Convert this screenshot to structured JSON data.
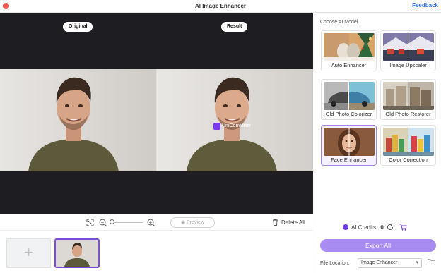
{
  "window": {
    "title": "AI Image Enhancer",
    "feedback_link": "Feedback"
  },
  "preview": {
    "original_label": "Original",
    "result_label": "Result",
    "watermark_text": "UniConverter"
  },
  "toolbar": {
    "icons": [
      "fit-screen-icon",
      "zoom-out-icon",
      "zoom-in-icon",
      "trash-icon",
      "eye-icon"
    ],
    "preview_label": "Preview",
    "delete_all_label": "Delete All",
    "zoom_level": 0.1
  },
  "thumbnails": {
    "add_glyph": "+",
    "count": 1
  },
  "panel": {
    "heading": "Choose AI Model",
    "models": [
      {
        "label": "Auto Enhancer",
        "selected": false
      },
      {
        "label": "Image Upscaler",
        "selected": false
      },
      {
        "label": "Old Photo Colorizer",
        "selected": false
      },
      {
        "label": "Old Photo Restorer",
        "selected": false
      },
      {
        "label": "Face Enhancer",
        "selected": true
      },
      {
        "label": "Color Correction",
        "selected": false
      }
    ],
    "credits_label": "AI Credits:",
    "credits_value": "0",
    "export_label": "Export All",
    "file_location_label": "File Location:",
    "file_location_value": "Image Enhancer"
  },
  "colors": {
    "accent": "#a98cf2",
    "accent_dark": "#7b4ce0",
    "preview_bg": "#1e1e22",
    "close_button": "#ee5a52",
    "link": "#2f6fe4"
  }
}
